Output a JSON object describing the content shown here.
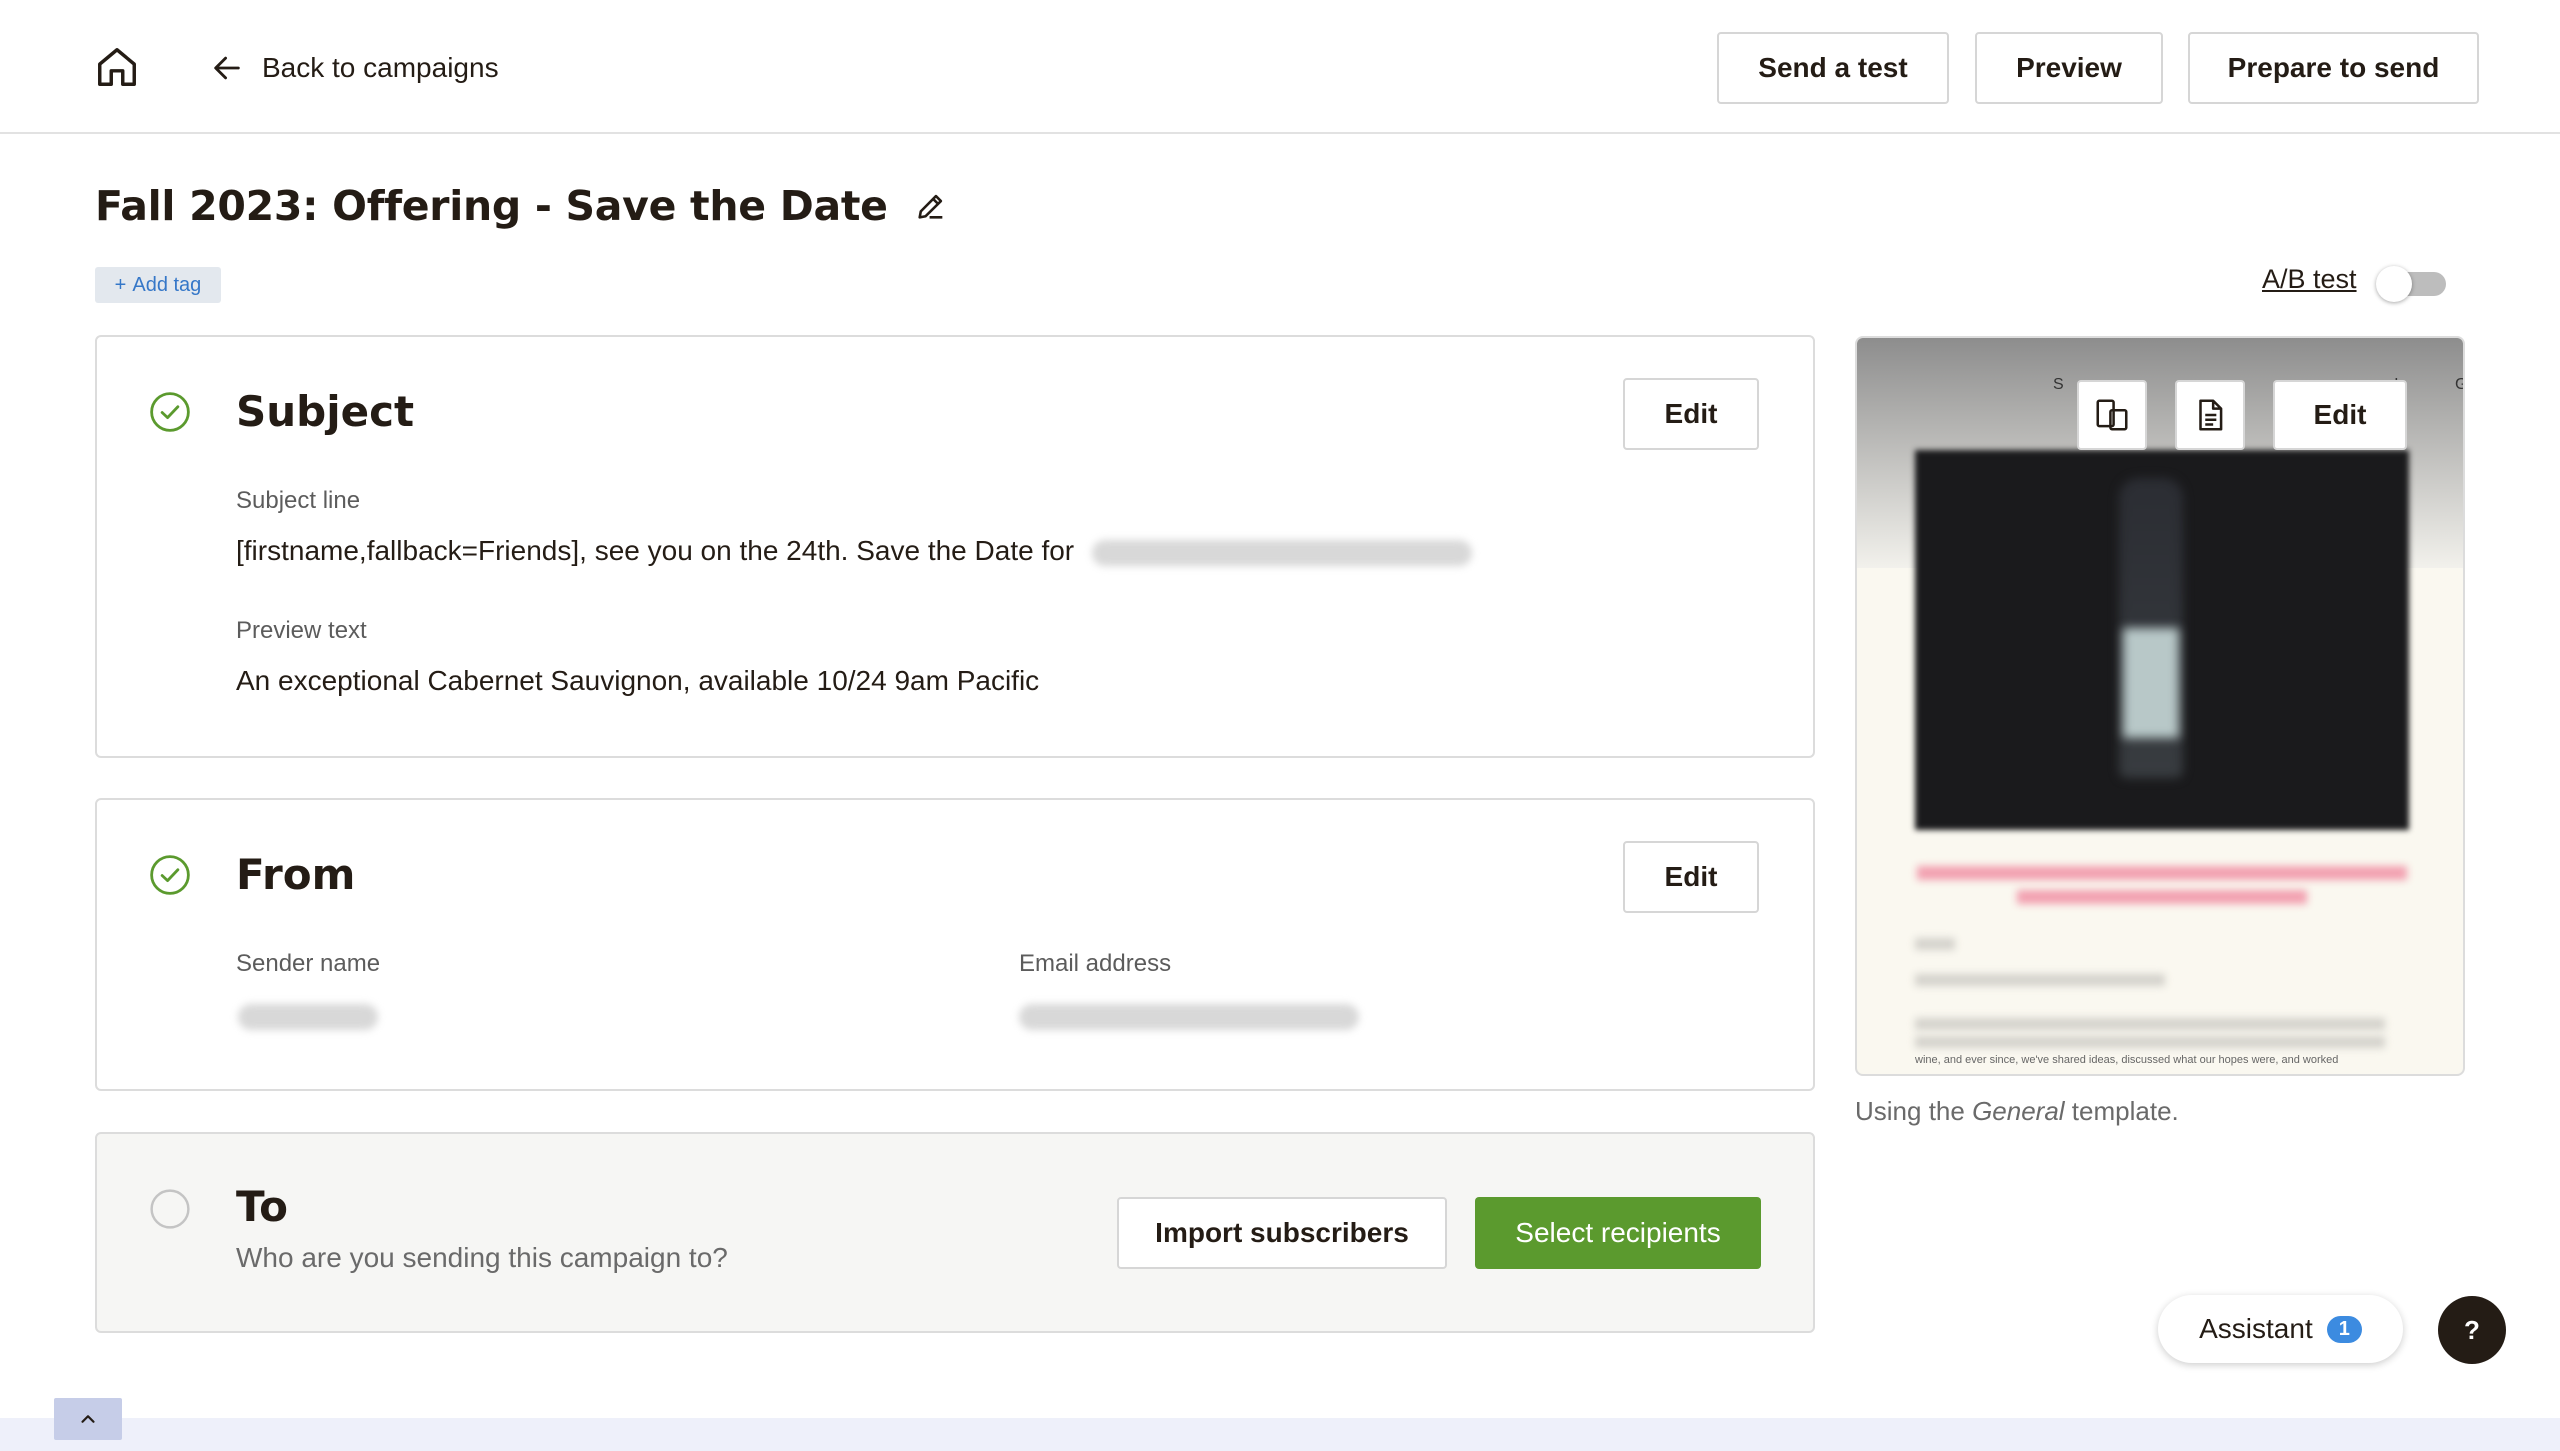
{
  "header": {
    "back_label": "Back to campaigns",
    "send_test_label": "Send a test",
    "preview_label": "Preview",
    "prepare_label": "Prepare to send"
  },
  "campaign": {
    "title": "Fall 2023: Offering - Save the Date",
    "add_tag_label": "Add tag",
    "ab_test_label": "A/B test",
    "ab_test_enabled": false
  },
  "subject_card": {
    "heading": "Subject",
    "edit_label": "Edit",
    "subject_line_label": "Subject line",
    "subject_line_value": "[firstname,fallback=Friends], see you on the 24th. Save the Date for",
    "preview_text_label": "Preview text",
    "preview_text_value": "An exceptional Cabernet Sauvignon, available 10/24 9am Pacific"
  },
  "from_card": {
    "heading": "From",
    "edit_label": "Edit",
    "sender_name_label": "Sender name",
    "email_label": "Email address"
  },
  "to_card": {
    "heading": "To",
    "subtitle": "Who are you sending this campaign to?",
    "import_label": "Import subscribers",
    "select_label": "Select recipients"
  },
  "preview_panel": {
    "edit_label": "Edit",
    "template_prefix": "Using the ",
    "template_name": "General",
    "template_suffix": " template.",
    "micro_text": "wine, and ever since, we've shared ideas, discussed what our hopes were, and worked"
  },
  "assistant": {
    "label": "Assistant",
    "badge_count": "1"
  },
  "help_label": "?",
  "colors": {
    "accent_green": "#5b9a2e",
    "text": "#241c15",
    "check_green": "#5b9a2e",
    "badge_blue": "#3c8be0"
  }
}
